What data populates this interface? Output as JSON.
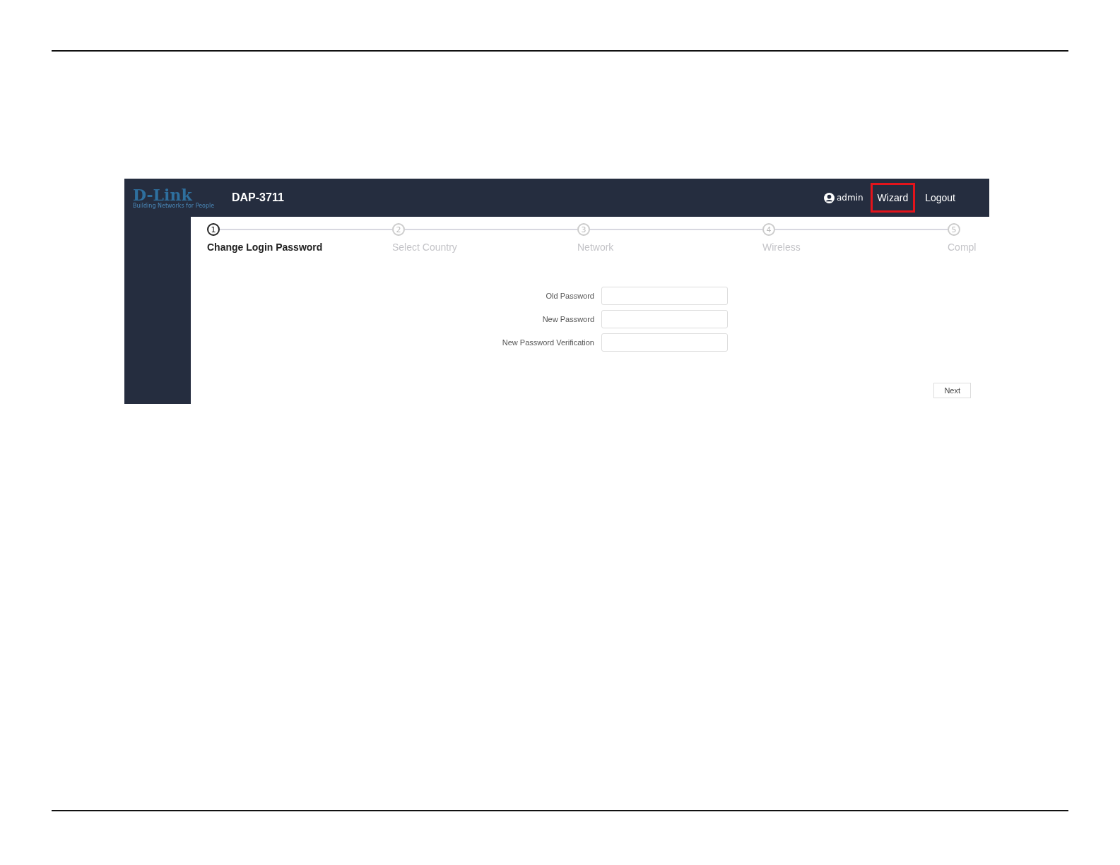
{
  "header": {
    "logo": "D-Link",
    "tagline": "Building Networks for People",
    "device": "DAP-3711",
    "user": "admin",
    "nav": [
      {
        "label": "Wizard",
        "highlighted": true
      },
      {
        "label": "Logout",
        "highlighted": false
      }
    ]
  },
  "steps": [
    {
      "number": "1",
      "label": "Change Login Password",
      "selected": true
    },
    {
      "number": "2",
      "label": "Select Country",
      "selected": false
    },
    {
      "number": "3",
      "label": "Network",
      "selected": false
    },
    {
      "number": "4",
      "label": "Wireless",
      "selected": false
    },
    {
      "number": "5",
      "label": "Compl",
      "selected": false
    }
  ],
  "form": [
    {
      "label": "Old Password"
    },
    {
      "label": "New Password"
    },
    {
      "label": "New Password Verification"
    }
  ],
  "next_button": "Next"
}
